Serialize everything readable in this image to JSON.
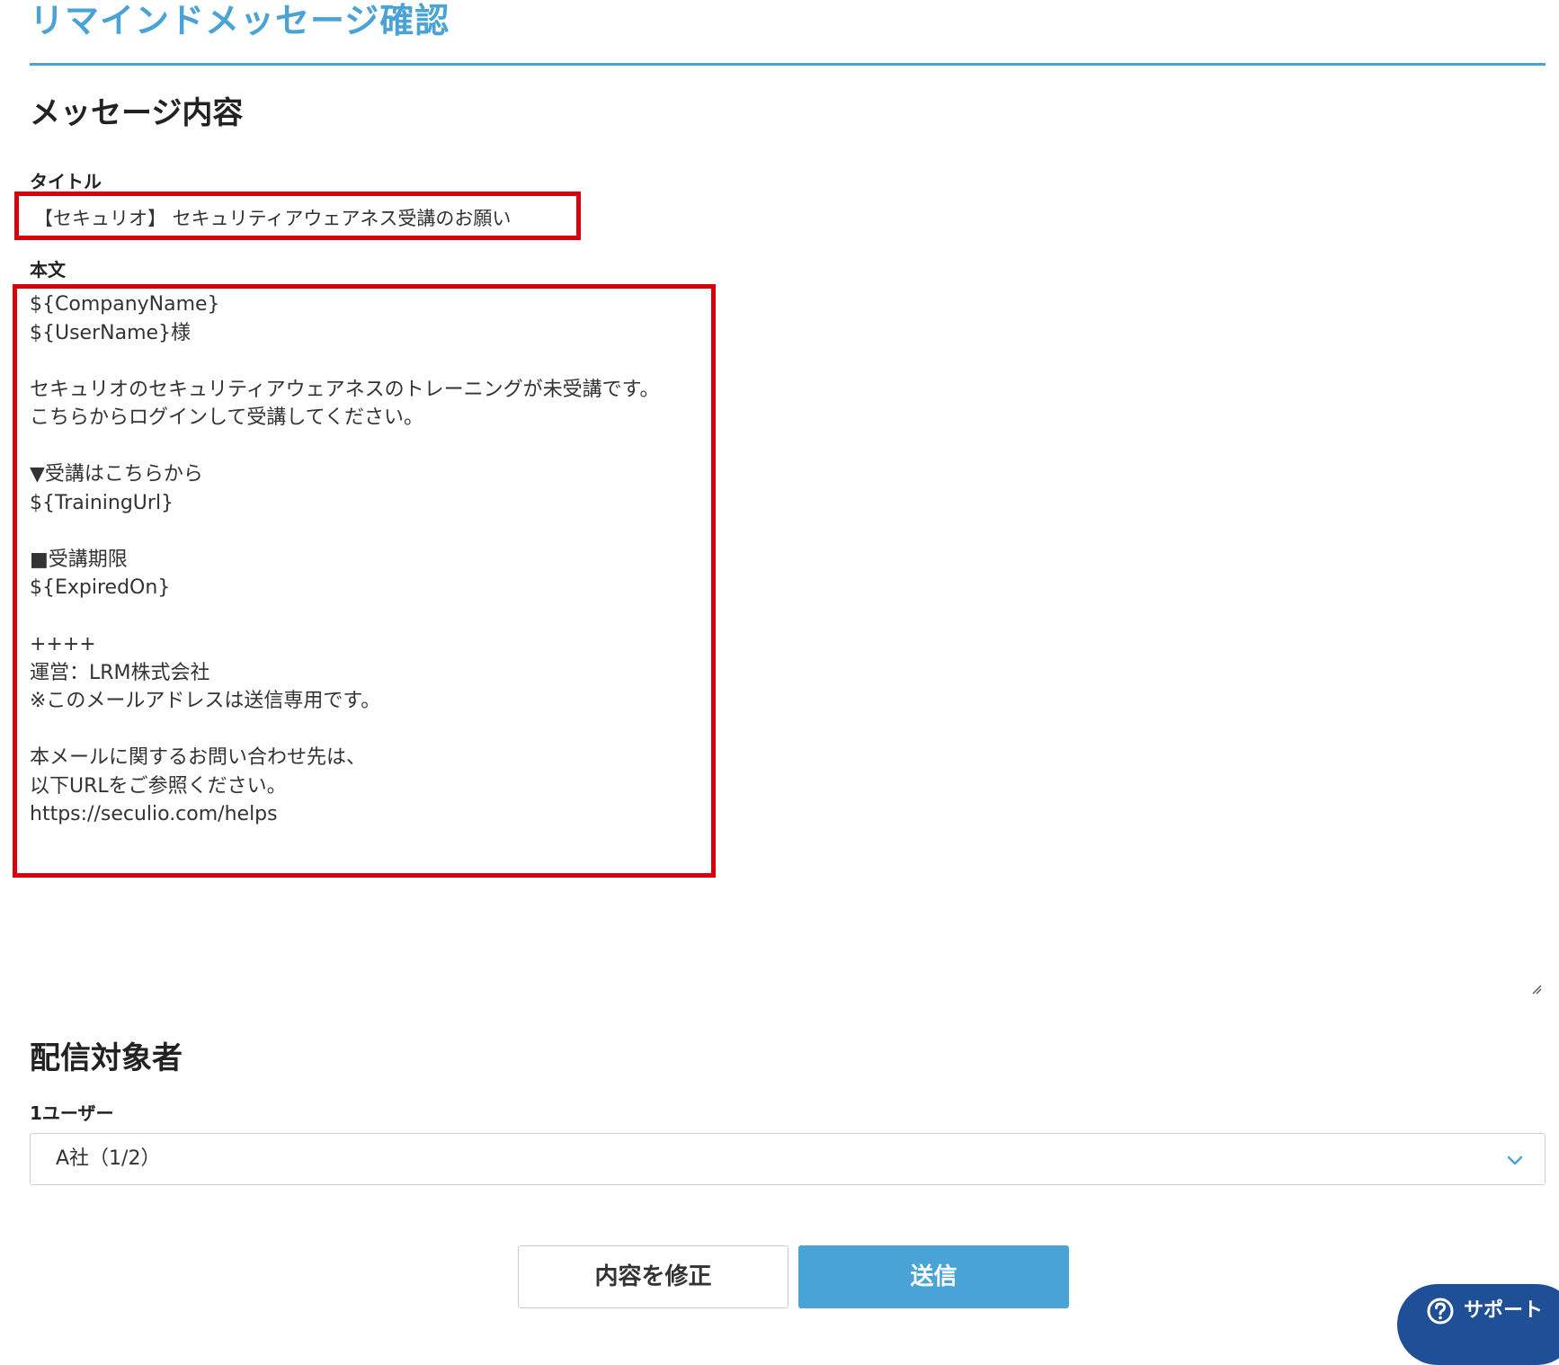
{
  "page": {
    "title": "リマインドメッセージ確認"
  },
  "message_section": {
    "heading": "メッセージ内容",
    "title_label": "タイトル",
    "title_value": "【セキュリオ】 セキュリティアウェアネス受講のお願い",
    "body_label": "本文",
    "body_lines": [
      "${CompanyName}",
      "${UserName}様",
      "",
      "セキュリオのセキュリティアウェアネスのトレーニングが未受講です。",
      "こちらからログインして受講してください。",
      "",
      "▼受講はこちらから",
      "${TrainingUrl}",
      "",
      "■受講期限",
      "${ExpiredOn}",
      "",
      "++++",
      "運営：LRM株式会社",
      "※このメールアドレスは送信専用です。",
      "",
      "本メールに関するお問い合わせ先は、",
      "以下URLをご参照ください。",
      "https://seculio.com/helps"
    ]
  },
  "recipients_section": {
    "heading": "配信対象者",
    "users_label": "1ユーザー",
    "selected_value": "A社（1/2）"
  },
  "actions": {
    "edit_label": "内容を修正",
    "send_label": "送信"
  },
  "support": {
    "label": "サポート",
    "icon": "question-circle-icon"
  },
  "colors": {
    "accent": "#4aa3d6",
    "highlight": "#d9000d",
    "support": "#1f4f96"
  }
}
